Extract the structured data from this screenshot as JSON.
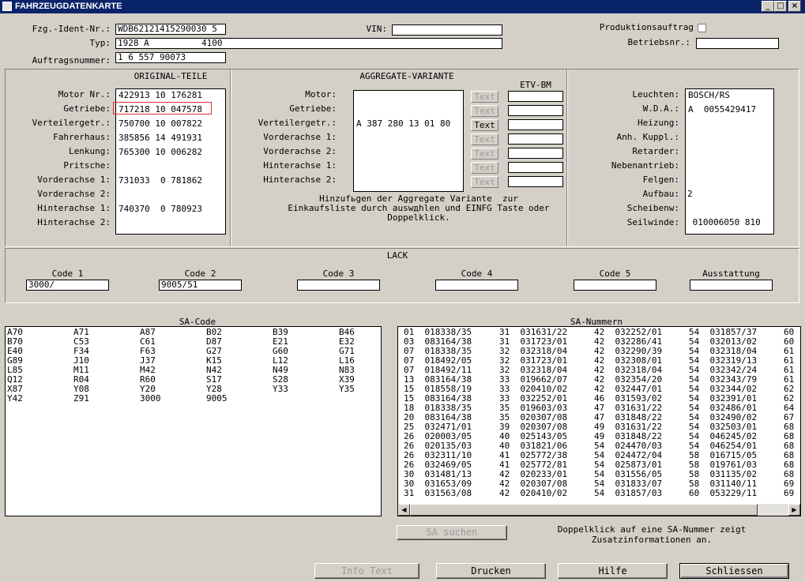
{
  "window": {
    "title": "FAHRZEUGDATENKARTE",
    "minimize": "_",
    "maximize": "□",
    "close": "×"
  },
  "header": {
    "fin_label": "Fzg.-Ident-Nr.:",
    "fin_value": "WDB62121415290030 5",
    "typ_label": "Typ:",
    "typ_value": "1928 A          4100",
    "auftrag_label": "Auftragsnummer:",
    "auftrag_value": "1 6 557 90073",
    "vin_label": "VIN:",
    "vin_value": "",
    "prod_label": "Produktionsauftrag",
    "betrieb_label": "Betriebsnr.:",
    "betrieb_value": ""
  },
  "original": {
    "title": "ORIGINAL-TEILE",
    "labels": [
      "Motor Nr.:",
      "Getriebe:",
      "Verteilergetr.:",
      "Fahrerhaus:",
      "Lenkung:",
      "Pritsche:",
      "Vorderachse 1:",
      "Vorderachse 2:",
      "Hinterachse 1:",
      "Hinterachse 2:"
    ],
    "values": [
      "422913 10 176281",
      "717218 10 047578",
      "750700 10 007822",
      "385856 14 491931",
      "765300 10 006282",
      "",
      "731033  0 781862",
      "",
      "740370  0 780923",
      ""
    ]
  },
  "aggregate": {
    "title": "AGGREGATE-VARIANTE",
    "etv_title": "ETV-BM",
    "labels": [
      "Motor:",
      "Getriebe:",
      "Verteilergetr.:",
      "Vorderachse 1:",
      "Vorderachse 2:",
      "Hinterachse 1:",
      "Hinterachse 2:"
    ],
    "list_items": [
      "A 387 280 13 01 80"
    ],
    "text_button": "Text",
    "hint_line1": "Hinzufьgen der Aggregate Variante  zur",
    "hint_line2": "Einkaufsliste durch auswдhlen und EINFG Taste oder",
    "hint_line3": "Doppelklick."
  },
  "extras": {
    "labels": [
      "Leuchten:",
      "W.D.A.:",
      "Heizung:",
      "Anh. Kuppl.:",
      "Retarder:",
      "Nebenantrieb:",
      "Felgen:",
      "Aufbau:",
      "Scheibenw:",
      "Seilwinde:"
    ],
    "list_items": [
      "BOSCH/RS",
      "A  0055429417"
    ],
    "aufbau_value": "2",
    "seilwinde_value": " 010006050 810"
  },
  "lack": {
    "title": "LACK",
    "code1_label": "Code 1",
    "code1_value": "3000/",
    "code2_label": "Code 2",
    "code2_value": "9005/51",
    "code3_label": "Code 3",
    "code3_value": "",
    "code4_label": "Code 4",
    "code4_value": "",
    "code5_label": "Code 5",
    "code5_value": "",
    "ausstattung_label": "Ausstattung",
    "ausstattung_value": ""
  },
  "sa_code": {
    "title": "SA-Code",
    "rows": [
      [
        "A70",
        "A71",
        "A87",
        "B02",
        "B39",
        "B46"
      ],
      [
        "B70",
        "C53",
        "C61",
        "D87",
        "E21",
        "E32"
      ],
      [
        "E40",
        "F34",
        "F63",
        "G27",
        "G60",
        "G71"
      ],
      [
        "G89",
        "J10",
        "J37",
        "K15",
        "L12",
        "L16"
      ],
      [
        "L85",
        "M11",
        "M42",
        "N42",
        "N49",
        "N83"
      ],
      [
        "Q12",
        "R04",
        "R60",
        "S17",
        "S28",
        "X39"
      ],
      [
        "X87",
        "Y08",
        "Y20",
        "Y28",
        "Y33",
        "Y35"
      ],
      [
        "Y42",
        "Z91",
        "3000",
        "9005",
        "",
        ""
      ]
    ]
  },
  "sa_nummern": {
    "title": "SA-Nummern",
    "rows": [
      [
        "01  018338/35",
        "31  031631/22",
        "42  032252/01",
        "54  031857/37",
        "60"
      ],
      [
        "03  083164/38",
        "31  031723/01",
        "42  032286/41",
        "54  032013/02",
        "60"
      ],
      [
        "07  018338/35",
        "32  032318/04",
        "42  032290/39",
        "54  032318/04",
        "61"
      ],
      [
        "07  018492/05",
        "32  031723/01",
        "42  032308/01",
        "54  032319/13",
        "61"
      ],
      [
        "07  018492/11",
        "32  032318/04",
        "42  032318/04",
        "54  032342/24",
        "61"
      ],
      [
        "13  083164/38",
        "33  019662/07",
        "42  032354/20",
        "54  032343/79",
        "61"
      ],
      [
        "15  018558/19",
        "33  020410/02",
        "42  032447/01",
        "54  032344/02",
        "62"
      ],
      [
        "15  083164/38",
        "33  032252/01",
        "46  031593/02",
        "54  032391/01",
        "62"
      ],
      [
        "18  018338/35",
        "35  019603/03",
        "47  031631/22",
        "54  032486/01",
        "64"
      ],
      [
        "20  083164/38",
        "35  020307/08",
        "47  031848/22",
        "54  032490/02",
        "67"
      ],
      [
        "25  032471/01",
        "39  020307/08",
        "49  031631/22",
        "54  032503/01",
        "68"
      ],
      [
        "26  020003/05",
        "40  025143/05",
        "49  031848/22",
        "54  046245/02",
        "68"
      ],
      [
        "26  020135/03",
        "40  031821/06",
        "54  024470/03",
        "54  046254/01",
        "68"
      ],
      [
        "26  032311/10",
        "41  025772/38",
        "54  024472/04",
        "58  016715/05",
        "68"
      ],
      [
        "26  032469/05",
        "41  025772/81",
        "54  025873/01",
        "58  019761/03",
        "68"
      ],
      [
        "30  031481/13",
        "42  020233/01",
        "54  031556/05",
        "58  031135/02",
        "68"
      ],
      [
        "30  031653/09",
        "42  020307/08",
        "54  031833/07",
        "58  031140/11",
        "69"
      ],
      [
        "31  031563/08",
        "42  020410/02",
        "54  031857/03",
        "60  053229/11",
        "69"
      ]
    ]
  },
  "sa_suchen": "SA suchen",
  "sa_hint_line1": "Doppelklick auf eine SA-Nummer zeigt",
  "sa_hint_line2": "Zusatzinformationen an.",
  "buttons": {
    "info_text": "Info Text",
    "drucken": "Drucken",
    "hilfe": "Hilfe",
    "schliessen": "Schliessen"
  }
}
